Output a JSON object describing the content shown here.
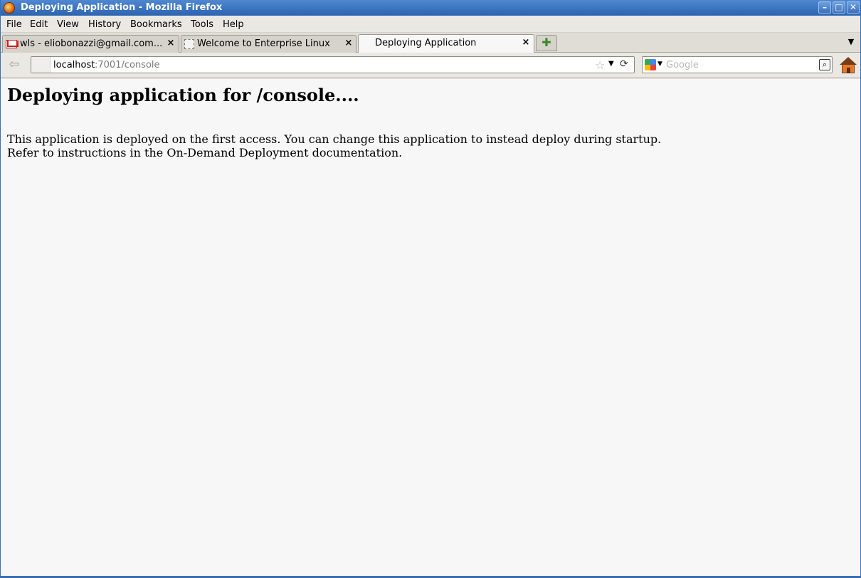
{
  "window": {
    "title": "Deploying Application - Mozilla Firefox",
    "minimize_glyph": "–",
    "maximize_glyph": "□",
    "close_glyph": "✕"
  },
  "menu": {
    "items": [
      "File",
      "Edit",
      "View",
      "History",
      "Bookmarks",
      "Tools",
      "Help"
    ]
  },
  "tabs": [
    {
      "label": "wls - eliobonazzi@gmail.com...",
      "icon": "gmail-icon",
      "active": false
    },
    {
      "label": "Welcome to Enterprise Linux",
      "icon": "blank-page-icon",
      "active": false
    },
    {
      "label": "Deploying Application",
      "icon": "none",
      "active": true
    }
  ],
  "tab_close_glyph": "×",
  "new_tab_glyph": "✚",
  "all_tabs_glyph": "▼",
  "nav": {
    "back_glyph": "⇦",
    "url_host": "localhost",
    "url_rest": ":7001/console",
    "bookmark_star_glyph": "☆",
    "url_dropdown_glyph": "▼",
    "go_glyph": "⟳"
  },
  "search": {
    "placeholder": "Google",
    "engine_dropdown_glyph": "▼",
    "go_glyph": "⌕"
  },
  "page": {
    "heading": "Deploying application for /console....",
    "line1": "This application is deployed on the first access. You can change this application to instead deploy during startup.",
    "line2": "Refer to instructions in the On-Demand Deployment documentation."
  },
  "colors": {
    "titlebar": "#2d64b0",
    "content_bg": "#f7f7f7",
    "chrome_bg": "#eae8e3"
  }
}
